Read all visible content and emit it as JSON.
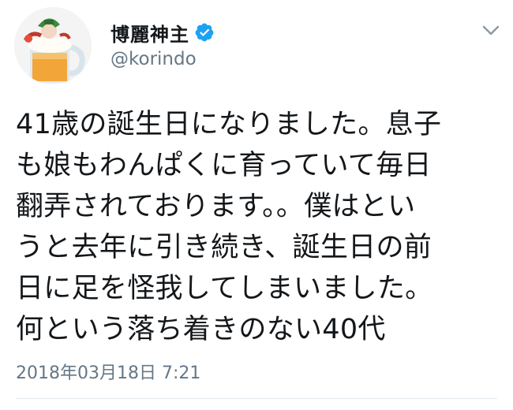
{
  "tweet": {
    "author": {
      "display_name": "博麗神主",
      "handle": "@korindo",
      "verified_icon": "verified-badge-icon",
      "avatar_icon": "beer-mug-avatar"
    },
    "menu_icon": "chevron-down-icon",
    "text_lines": [
      "41歳の誕生日になりました。息子",
      "も娘もわんぱくに育っていて毎日",
      "翻弄されております。。僕はとい",
      "うと去年に引き続き、誕生日の前",
      "日に足を怪我してしまいました。",
      "何という落ち着きのない40代"
    ],
    "timestamp": "2018年03月18日 7:21"
  },
  "colors": {
    "text": "#14171a",
    "secondary_text": "#657786",
    "verified_blue": "#1da1f2",
    "divider": "#e1e8ed",
    "background": "#ffffff"
  }
}
